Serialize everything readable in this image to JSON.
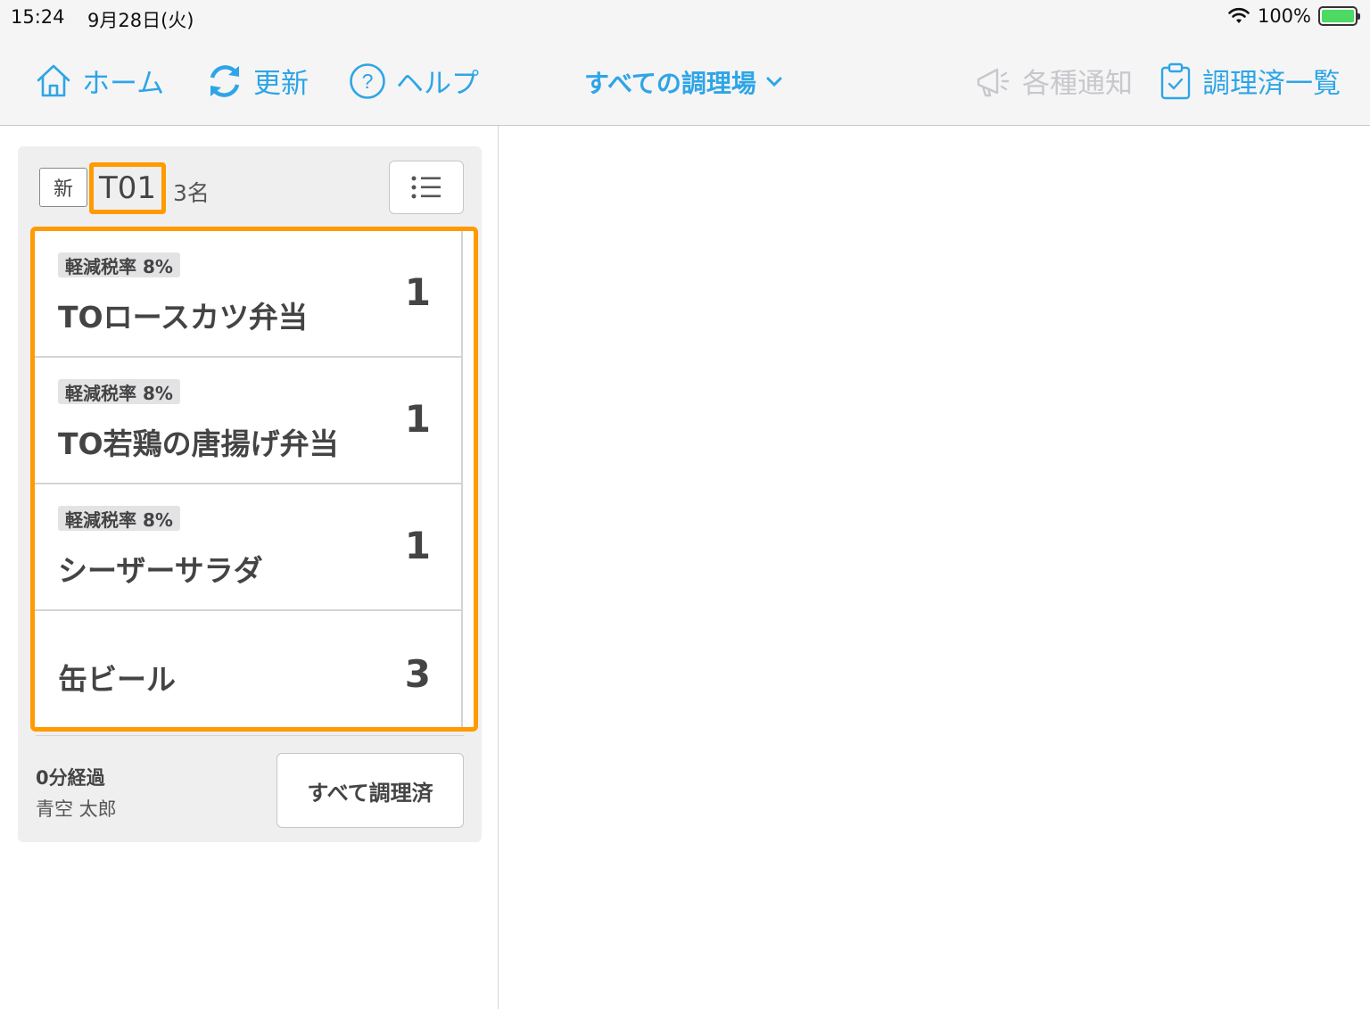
{
  "status_bar": {
    "time": "15:24",
    "date": "9月28日(火)",
    "battery": "100%"
  },
  "nav": {
    "home": "ホーム",
    "refresh": "更新",
    "help": "ヘルプ",
    "kitchen_selector": "すべての調理場",
    "notifications": "各種通知",
    "cooked_list": "調理済一覧"
  },
  "colors": {
    "accent": "#2ea5e6",
    "highlight": "#ff9a00",
    "disabled": "#c8c8cc"
  },
  "order": {
    "new_badge": "新",
    "table": "T01",
    "guests": "3名",
    "items": [
      {
        "tax": "軽減税率 8%",
        "name": "TOロースカツ弁当",
        "qty": "1"
      },
      {
        "tax": "軽減税率 8%",
        "name": "TO若鶏の唐揚げ弁当",
        "qty": "1"
      },
      {
        "tax": "軽減税率 8%",
        "name": "シーザーサラダ",
        "qty": "1"
      },
      {
        "tax": "",
        "name": "缶ビール",
        "qty": "3"
      }
    ],
    "elapsed": "0分経過",
    "staff": "青空 太郎",
    "complete_all": "すべて調理済"
  }
}
